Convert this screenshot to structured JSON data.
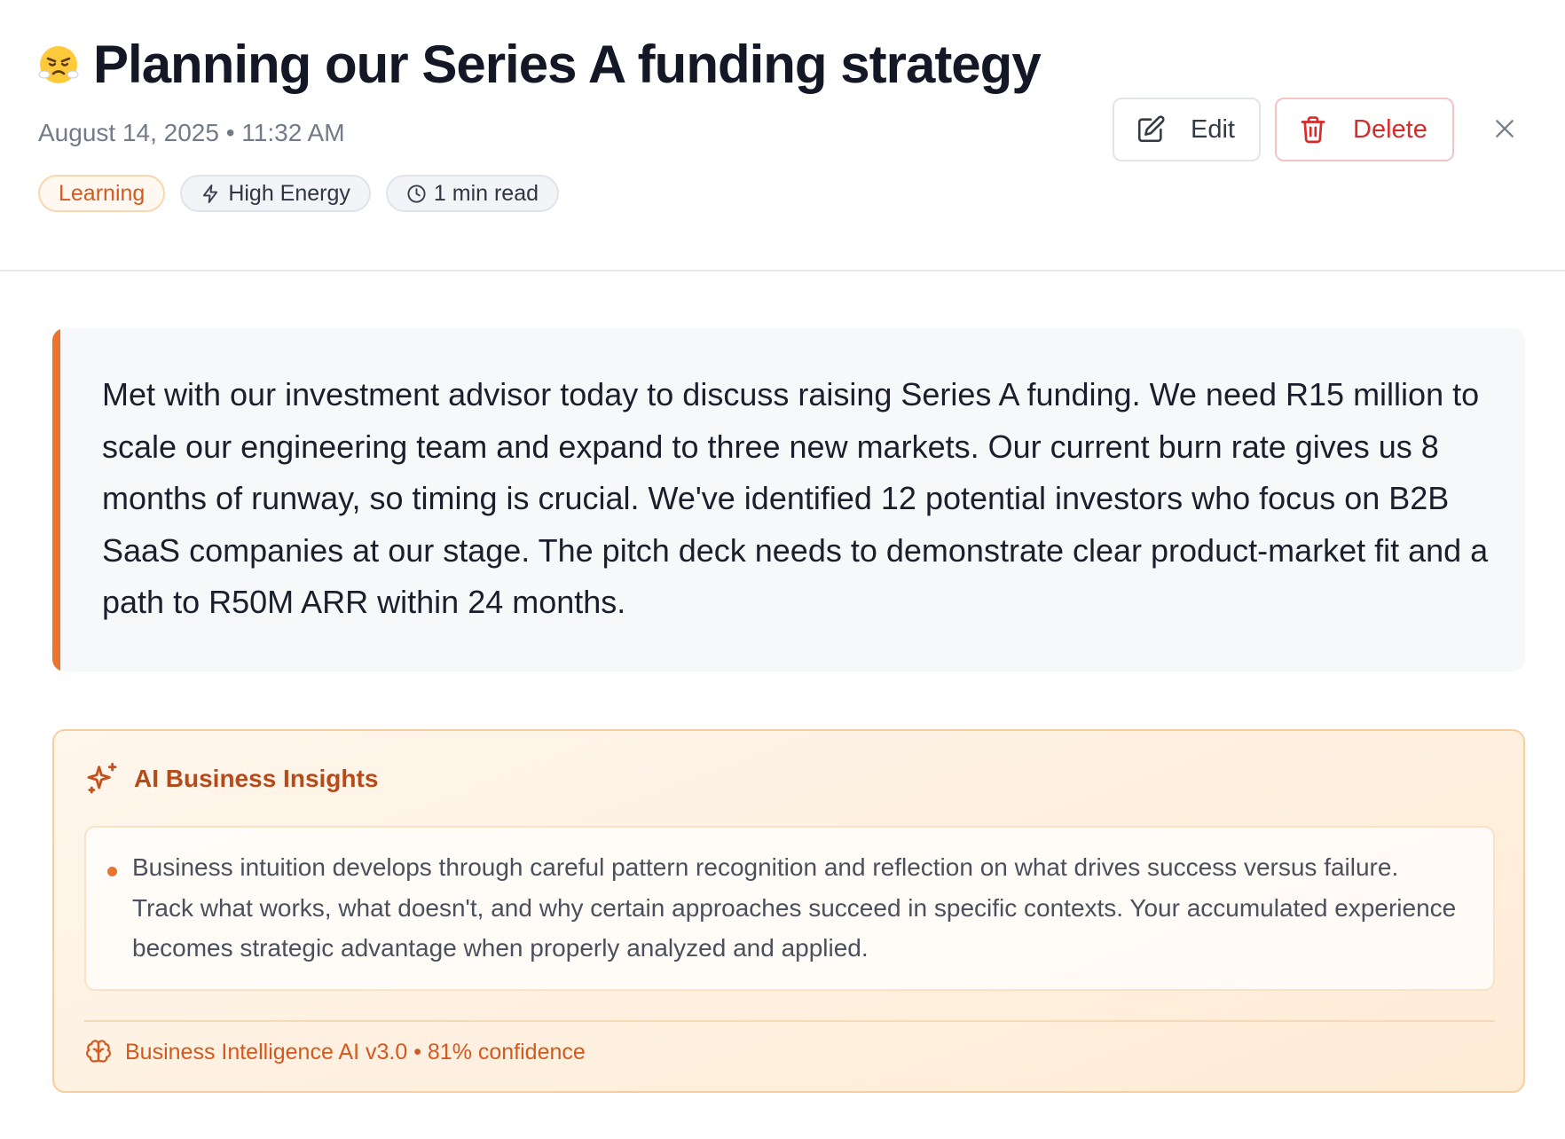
{
  "header": {
    "mood_emoji": "frustrated-face",
    "title": "Planning our Series A funding strategy",
    "datetime": "August 14, 2025 • 11:32 AM",
    "tags": {
      "category": "Learning",
      "energy": "High Energy",
      "read_time": "1 min read"
    },
    "actions": {
      "edit_label": "Edit",
      "delete_label": "Delete"
    }
  },
  "entry": {
    "body": "Met with our investment advisor today to discuss raising Series A funding. We need R15 million to scale our engineering team and expand to three new markets. Our current burn rate gives us 8 months of runway, so timing is crucial. We've identified 12 potential investors who focus on B2B SaaS companies at our stage. The pitch deck needs to demonstrate clear product-market fit and a path to R50M ARR within 24 months."
  },
  "insights": {
    "title": "AI Business Insights",
    "items": [
      "Business intuition develops through careful pattern recognition and reflection on what drives success versus failure. Track what works, what doesn't, and why certain approaches succeed in specific contexts. Your accumulated experience becomes strategic advantage when properly analyzed and applied."
    ],
    "footer": "Business Intelligence AI v3.0 • 81% confidence"
  },
  "colors": {
    "accent": "#e8742e",
    "delete": "#d52b2b",
    "insight_title": "#b54a1a"
  }
}
